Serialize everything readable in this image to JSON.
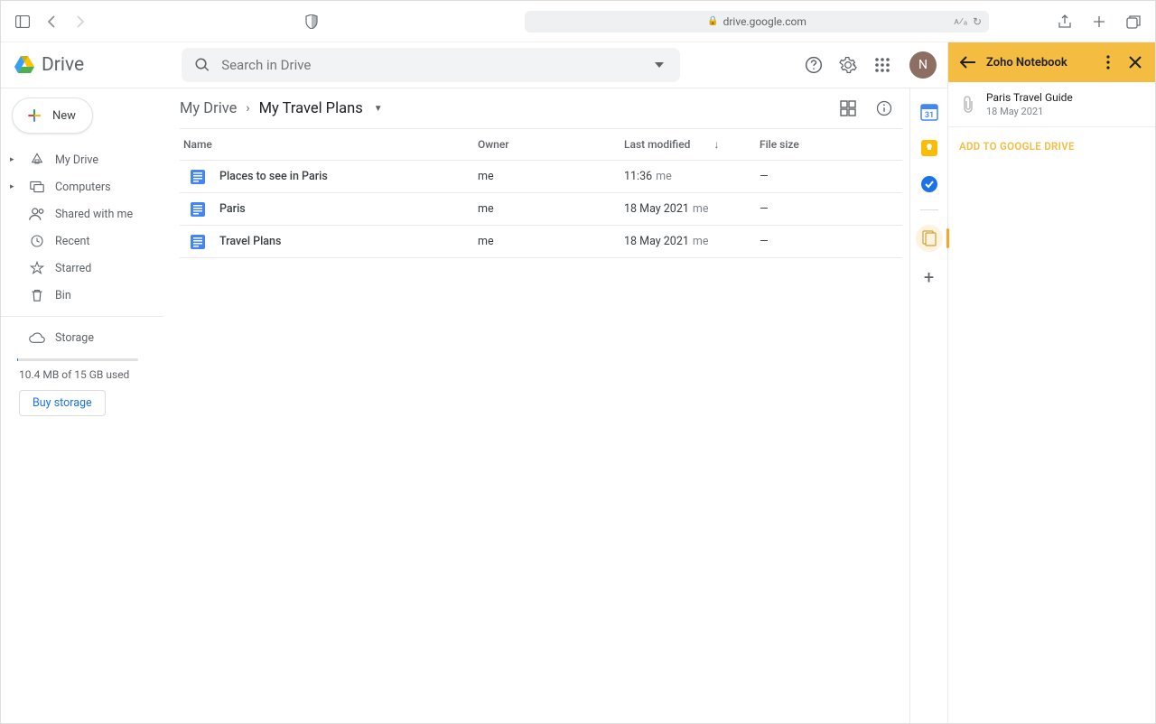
{
  "browser": {
    "url": "drive.google.com"
  },
  "header": {
    "app_name": "Drive",
    "search_placeholder": "Search in Drive",
    "avatar_letter": "N"
  },
  "sidebar": {
    "new_label": "New",
    "items": [
      {
        "label": "My Drive"
      },
      {
        "label": "Computers"
      },
      {
        "label": "Shared with me"
      },
      {
        "label": "Recent"
      },
      {
        "label": "Starred"
      },
      {
        "label": "Bin"
      }
    ],
    "storage_label": "Storage",
    "storage_used": "10.4 MB of 15 GB used",
    "buy_label": "Buy storage"
  },
  "breadcrumb": {
    "root": "My Drive",
    "current": "My Travel Plans"
  },
  "columns": {
    "name": "Name",
    "owner": "Owner",
    "modified": "Last modified",
    "size": "File size"
  },
  "files": [
    {
      "name": "Places to see in Paris",
      "owner": "me",
      "modified": "11:36",
      "who": "me",
      "size": "—"
    },
    {
      "name": "Paris",
      "owner": "me",
      "modified": "18 May 2021",
      "who": "me",
      "size": "—"
    },
    {
      "name": "Travel Plans",
      "owner": "me",
      "modified": "18 May 2021",
      "who": "me",
      "size": "—"
    }
  ],
  "zoho": {
    "title": "Zoho Notebook",
    "note_title": "Paris Travel Guide",
    "note_date": "18 May 2021",
    "add_label": "ADD TO GOOGLE DRIVE"
  }
}
